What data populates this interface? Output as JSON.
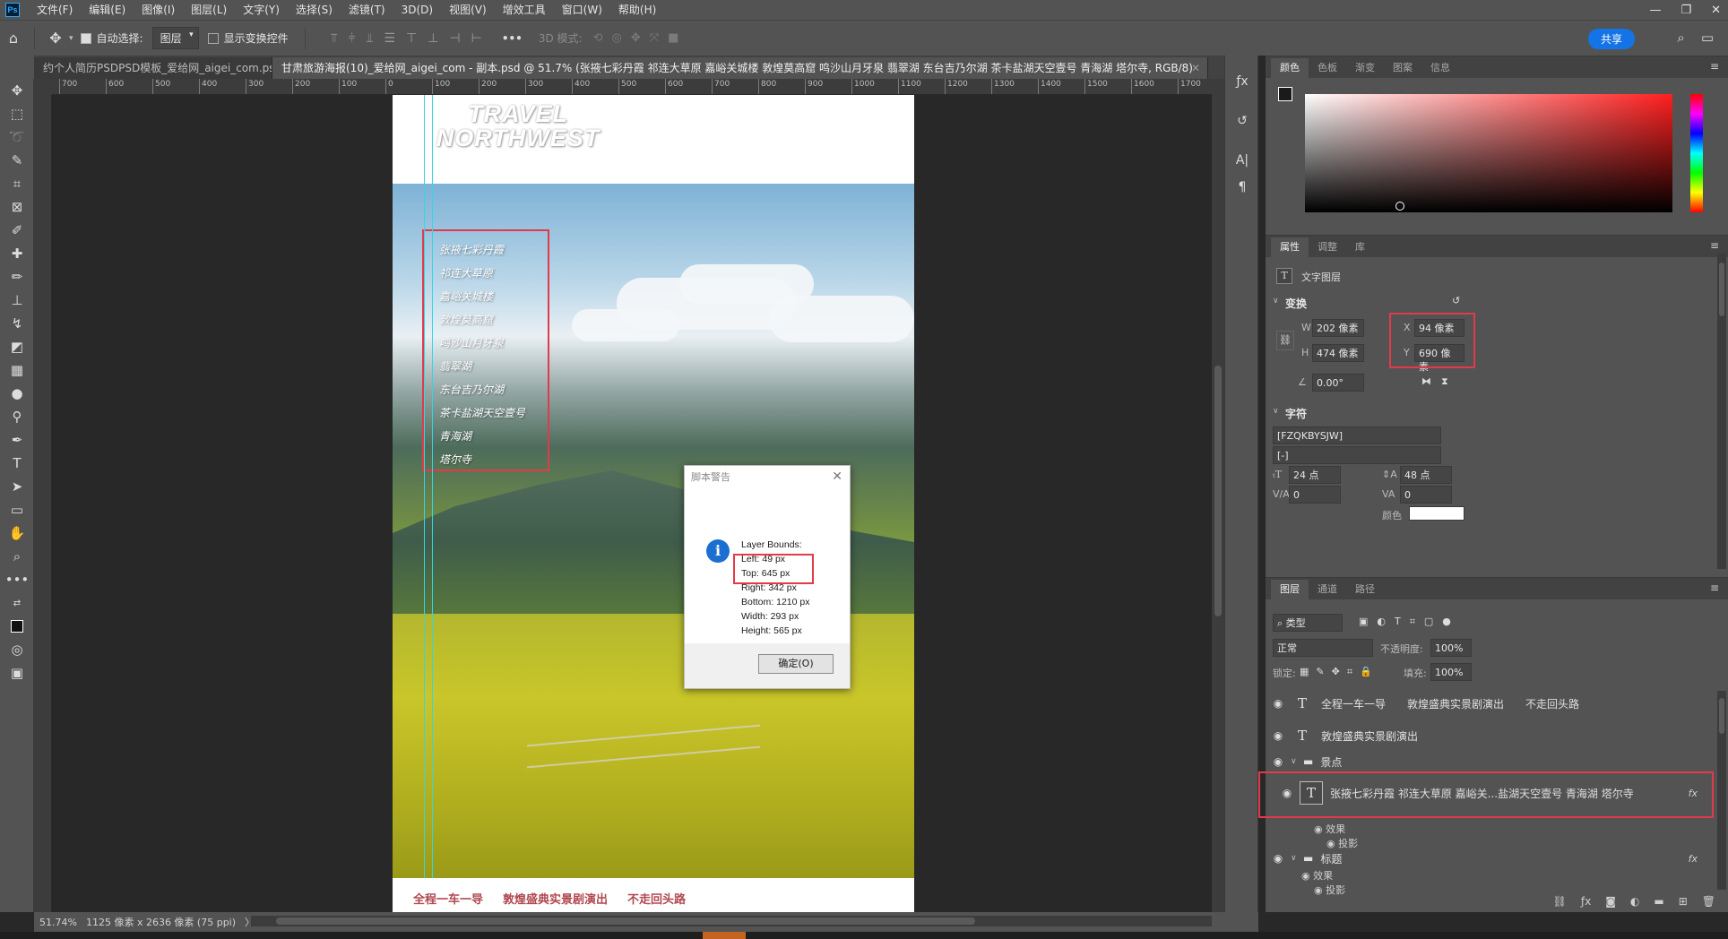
{
  "app": {
    "logo": "Ps"
  },
  "menu": [
    "文件(F)",
    "编辑(E)",
    "图像(I)",
    "图层(L)",
    "文字(Y)",
    "选择(S)",
    "滤镜(T)",
    "3D(D)",
    "视图(V)",
    "增效工具",
    "窗口(W)",
    "帮助(H)"
  ],
  "window_controls": {
    "minimize": "—",
    "restore": "❐",
    "close": "✕"
  },
  "options": {
    "auto_select_label": "自动选择:",
    "auto_select_value": "图层",
    "show_transform_label": "显示变换控件",
    "mode3d_label": "3D 模式:",
    "share_label": "共享",
    "more": "•••"
  },
  "tabs": [
    {
      "label": "约个人简历PSDPSD模板_爱给网_aigei_com.psd",
      "close": "✕"
    },
    {
      "label": "甘肃旅游海报(10)_爱给网_aigei_com - 副本.psd @ 51.7% (张掖七彩丹霞 祁连大草原 嘉峪关城楼 敦煌莫高窟 鸣沙山月牙泉 翡翠湖 东台吉乃尔湖 茶卡盐湖天空壹号 青海湖 塔尔寺, RGB/8)",
      "close": "✕"
    }
  ],
  "tabs_more": "»",
  "ruler": {
    "labels": [
      "700",
      "600",
      "500",
      "400",
      "300",
      "200",
      "100",
      "0",
      "100",
      "200",
      "300",
      "400",
      "500",
      "600",
      "700",
      "800",
      "900",
      "1000",
      "1100",
      "1200",
      "1300",
      "1400",
      "1500",
      "1600",
      "1700"
    ]
  },
  "poster": {
    "title_line1": "TRAVEL",
    "title_line2": "NORTHWEST",
    "spots": [
      "张掖七彩丹霞",
      "祁连大草原",
      "嘉峪关城楼",
      "敦煌莫高窟",
      "鸣沙山月牙泉",
      "翡翠湖",
      "东台吉乃尔湖",
      "茶卡盐湖天空壹号",
      "青海湖",
      "塔尔寺"
    ],
    "bottom": [
      "全程一车一导",
      "敦煌盛典实景剧演出",
      "不走回头路"
    ]
  },
  "dialog": {
    "title": "脚本警告",
    "close": "✕",
    "icon": "i",
    "lines": [
      "Layer Bounds:",
      "Left: 49 px",
      "Top: 645 px",
      "Right: 342 px",
      "Bottom: 1210 px",
      "Width: 293 px",
      "Height: 565 px"
    ],
    "ok_label": "确定(O)"
  },
  "status": {
    "zoom": "51.74%",
    "doc_info": "1125 像素 x 2636 像素 (75 ppi)",
    "arrow": "〉"
  },
  "color_panel": {
    "tabs": [
      "颜色",
      "色板",
      "渐变",
      "图案",
      "信息"
    ],
    "menu": "≡"
  },
  "properties_panel": {
    "tabs": [
      "属性",
      "调整",
      "库"
    ],
    "layer_type_icon": "T",
    "layer_type": "文字图层",
    "transform_header": "变换",
    "w_label": "W",
    "w_value": "202 像素",
    "h_label": "H",
    "h_value": "474 像素",
    "x_label": "X",
    "x_value": "94 像素",
    "y_label": "Y",
    "y_value": "690 像素",
    "angle_value": "0.00°",
    "char_header": "字符",
    "font_name": "[FZQKBYSJW]",
    "font_style": "[-]",
    "size_value": "24 点",
    "leading_value": "48 点",
    "kerning_value": "0",
    "tracking_value": "0",
    "color_label": "颜色"
  },
  "layers_panel": {
    "tabs": [
      "图层",
      "通道",
      "路径"
    ],
    "filter_label": "类型",
    "blend_mode": "正常",
    "opacity_label": "不透明度:",
    "opacity_value": "100%",
    "lock_label": "锁定:",
    "fill_label": "填充:",
    "fill_value": "100%",
    "layers": [
      {
        "name": "全程一车一导　　敦煌盛典实景剧演出　　不走回头路",
        "type": "T"
      },
      {
        "name": "敦煌盛典实景剧演出",
        "type": "T"
      },
      {
        "name": "景点",
        "type": "folder"
      },
      {
        "name": "张掖七彩丹霞 祁连大草原 嘉峪关...盐湖天空壹号 青海湖 塔尔寺",
        "type": "T",
        "fx": "fx"
      },
      {
        "name": "效果",
        "type": "effect"
      },
      {
        "name": "投影",
        "type": "effect"
      },
      {
        "name": "标题",
        "type": "folder",
        "fx": "fx"
      },
      {
        "name": "效果",
        "type": "effect"
      },
      {
        "name": "投影",
        "type": "effect"
      }
    ]
  }
}
